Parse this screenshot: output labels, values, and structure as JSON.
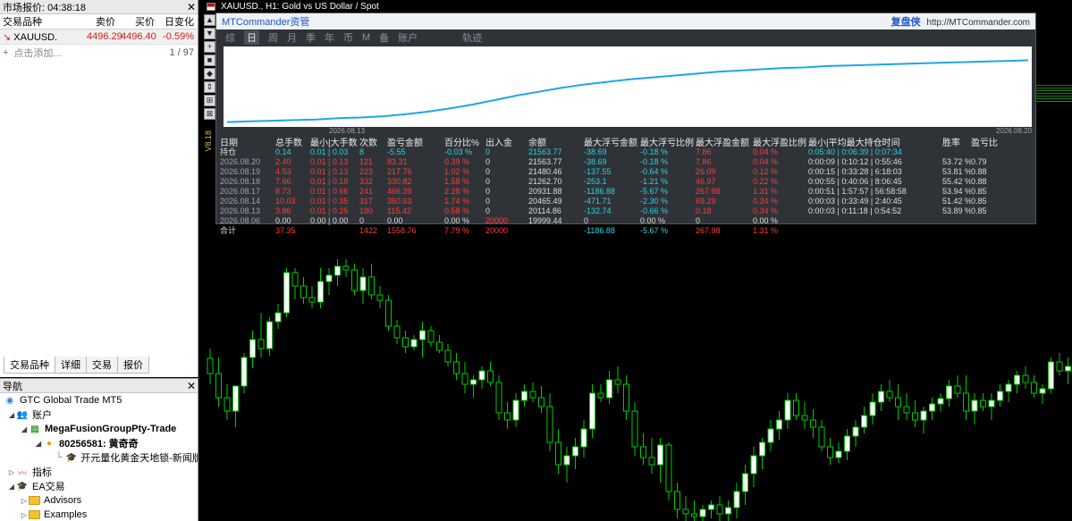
{
  "market_watch": {
    "title": "市场报价: 04:38:18",
    "columns": [
      "交易品种",
      "卖价",
      "买价",
      "日变化"
    ],
    "rows": [
      {
        "symbol": "XAUUSD.",
        "bid": "4496.29",
        "ask": "4496.40",
        "change": "-0.59%"
      }
    ],
    "add_label": "点击添加...",
    "count": "1 / 97",
    "tabs": [
      "交易品种",
      "详细",
      "交易",
      "报价"
    ]
  },
  "navigator": {
    "title": "导航",
    "items": [
      {
        "label": "GTC Global Trade MT5",
        "bold": false
      },
      {
        "label": "账户",
        "bold": false
      },
      {
        "label": "MegaFusionGroupPty-Trade",
        "bold": true
      },
      {
        "label": "80256581: 黄奇奇",
        "bold": true
      },
      {
        "label": "开元量化黄金天地锁-新闻版 - X",
        "bold": false
      },
      {
        "label": "指标",
        "bold": false
      },
      {
        "label": "EA交易",
        "bold": false
      },
      {
        "label": "Advisors",
        "bold": false
      },
      {
        "label": "Examples",
        "bold": false
      }
    ]
  },
  "chart": {
    "title": "XAUUSD., H1: Gold vs US Dollar / Spot",
    "ea_label": "V8.18",
    "toolstrip": [
      "▲",
      "▼",
      "+",
      "■",
      "◆",
      "⇕",
      "⊞",
      "⊠"
    ],
    "candles": [
      [
        401,
        390,
        430,
        418
      ],
      [
        418,
        400,
        455,
        445
      ],
      [
        445,
        430,
        470,
        460
      ],
      [
        460,
        440,
        478,
        432
      ],
      [
        432,
        395,
        440,
        400
      ],
      [
        400,
        370,
        412,
        380
      ],
      [
        380,
        350,
        400,
        390
      ],
      [
        390,
        355,
        398,
        360
      ],
      [
        360,
        340,
        368,
        350
      ],
      [
        350,
        300,
        355,
        305
      ],
      [
        305,
        300,
        335,
        320
      ],
      [
        320,
        310,
        340,
        333
      ],
      [
        333,
        320,
        345,
        338
      ],
      [
        338,
        300,
        345,
        315
      ],
      [
        315,
        300,
        330,
        308
      ],
      [
        308,
        290,
        320,
        298
      ],
      [
        298,
        290,
        310,
        302
      ],
      [
        302,
        295,
        330,
        325
      ],
      [
        325,
        300,
        340,
        310
      ],
      [
        310,
        295,
        335,
        330
      ],
      [
        330,
        320,
        345,
        336
      ],
      [
        336,
        330,
        370,
        365
      ],
      [
        365,
        358,
        385,
        378
      ],
      [
        378,
        370,
        395,
        388
      ],
      [
        388,
        375,
        392,
        380
      ],
      [
        380,
        360,
        400,
        370
      ],
      [
        370,
        365,
        388,
        383
      ],
      [
        383,
        375,
        395,
        392
      ],
      [
        392,
        385,
        410,
        405
      ],
      [
        405,
        395,
        425,
        418
      ],
      [
        418,
        405,
        440,
        430
      ],
      [
        430,
        420,
        445,
        425
      ],
      [
        425,
        410,
        435,
        415
      ],
      [
        415,
        405,
        432,
        428
      ],
      [
        428,
        420,
        470,
        462
      ],
      [
        462,
        450,
        480,
        470
      ],
      [
        470,
        440,
        478,
        448
      ],
      [
        448,
        430,
        455,
        438
      ],
      [
        438,
        428,
        450,
        445
      ],
      [
        445,
        432,
        462,
        455
      ],
      [
        455,
        440,
        505,
        495
      ],
      [
        495,
        480,
        530,
        520
      ],
      [
        520,
        500,
        540,
        510
      ],
      [
        510,
        490,
        525,
        500
      ],
      [
        500,
        470,
        512,
        480
      ],
      [
        480,
        430,
        490,
        440
      ],
      [
        440,
        430,
        450,
        445
      ],
      [
        445,
        415,
        452,
        425
      ],
      [
        425,
        410,
        440,
        430
      ],
      [
        430,
        420,
        470,
        460
      ],
      [
        460,
        450,
        510,
        500
      ],
      [
        500,
        485,
        520,
        512
      ],
      [
        512,
        490,
        530,
        520
      ],
      [
        520,
        490,
        540,
        498
      ],
      [
        498,
        495,
        560,
        550
      ],
      [
        550,
        540,
        580,
        570
      ],
      [
        570,
        555,
        583,
        575
      ],
      [
        575,
        560,
        583,
        578
      ],
      [
        578,
        565,
        583,
        570
      ],
      [
        570,
        560,
        580,
        565
      ],
      [
        565,
        555,
        583,
        575
      ],
      [
        575,
        560,
        583,
        568
      ],
      [
        568,
        540,
        580,
        550
      ],
      [
        550,
        520,
        565,
        530
      ],
      [
        530,
        500,
        545,
        510
      ],
      [
        510,
        490,
        525,
        495
      ],
      [
        495,
        470,
        505,
        480
      ],
      [
        480,
        460,
        492,
        470
      ],
      [
        470,
        440,
        480,
        448
      ],
      [
        448,
        440,
        470,
        465
      ],
      [
        465,
        450,
        480,
        470
      ],
      [
        470,
        458,
        490,
        478
      ],
      [
        478,
        470,
        505,
        500
      ],
      [
        500,
        490,
        520,
        512
      ],
      [
        512,
        495,
        518,
        505
      ],
      [
        505,
        480,
        515,
        488
      ],
      [
        488,
        470,
        500,
        478
      ],
      [
        478,
        455,
        485,
        465
      ],
      [
        465,
        440,
        475,
        450
      ],
      [
        450,
        430,
        460,
        438
      ],
      [
        438,
        425,
        450,
        445
      ],
      [
        445,
        430,
        470,
        455
      ],
      [
        455,
        440,
        470,
        462
      ],
      [
        462,
        448,
        478,
        470
      ],
      [
        470,
        455,
        485,
        460
      ],
      [
        460,
        445,
        470,
        452
      ],
      [
        452,
        440,
        460,
        446
      ],
      [
        446,
        425,
        455,
        432
      ],
      [
        432,
        420,
        445,
        440
      ],
      [
        440,
        420,
        470,
        460
      ],
      [
        460,
        440,
        475,
        448
      ],
      [
        448,
        440,
        460,
        455
      ],
      [
        455,
        440,
        470,
        448
      ],
      [
        448,
        430,
        455,
        438
      ],
      [
        438,
        425,
        450,
        430
      ],
      [
        430,
        415,
        440,
        420
      ],
      [
        420,
        410,
        435,
        428
      ],
      [
        428,
        420,
        445,
        440
      ],
      [
        440,
        430,
        452,
        435
      ],
      [
        435,
        400,
        440,
        405
      ],
      [
        405,
        395,
        420,
        415
      ],
      [
        415,
        400,
        430,
        410
      ]
    ]
  },
  "mtcommander": {
    "brand": "MTCommander资管",
    "header_right_strong": "复盘侠",
    "header_right_url": "http://MTCommander.com",
    "tabs": [
      "综",
      "日",
      "周",
      "月",
      "季",
      "年",
      "币",
      "M",
      "备",
      "账户",
      "轨迹"
    ],
    "active_tab": "日",
    "equity_dates": {
      "start": "2026.08.13",
      "end": "2026.08.20"
    },
    "equity_curve": [
      0.02,
      0.03,
      0.04,
      0.05,
      0.06,
      0.08,
      0.09,
      0.11,
      0.14,
      0.18,
      0.23,
      0.29,
      0.36,
      0.43,
      0.49,
      0.55,
      0.6,
      0.64,
      0.68,
      0.71,
      0.74,
      0.77,
      0.8,
      0.82,
      0.84,
      0.86,
      0.87,
      0.89,
      0.9,
      0.91,
      0.92,
      0.93,
      0.94,
      0.95,
      0.96,
      0.97,
      0.98
    ],
    "stats_header": [
      "日期",
      "总手数",
      "最小|大手数",
      "次数",
      "盈亏金额",
      "百分比%",
      "出入金",
      "余额",
      "最大浮亏金额",
      "最大浮亏比例",
      "最大浮盈金额",
      "最大浮盈比例",
      "最小|平均最大持仓时间",
      "胜率",
      "盈亏比"
    ],
    "holding": {
      "date": "持仓",
      "lots": "0.14",
      "min": "0.01 | 0.03",
      "count": "8",
      "pl": "-5.55",
      "pct": "-0.03 %",
      "io": "0",
      "balance": "21563.77",
      "mdd": "-38.69",
      "mddp": "-0.18 %",
      "mfe": "7.86",
      "mfep": "0.04 %",
      "time": "0:05:40 | 0:06:39 | 0:07:34",
      "win": "",
      "pf": ""
    },
    "rows": [
      {
        "date": "2026.08.20",
        "lots": "2.40",
        "min": "0.01 | 0.13",
        "count": "121",
        "pl": "83.31",
        "pct": "0.39 %",
        "io": "0",
        "balance": "21563.77",
        "mdd": "-38.69",
        "mddp": "-0.18 %",
        "mfe": "7.86",
        "mfep": "0.04 %",
        "time": "0:00:09 | 0:10:12 | 0:55:46",
        "win": "53.72 %",
        "pf": "0.79"
      },
      {
        "date": "2026.08.19",
        "lots": "4.53",
        "min": "0.01 | 0.13",
        "count": "223",
        "pl": "217.76",
        "pct": "1.02 %",
        "io": "0",
        "balance": "21480.46",
        "mdd": "-137.55",
        "mddp": "-0.64 %",
        "mfe": "26.09",
        "mfep": "0.12 %",
        "time": "0:00:15 | 0:33:28 | 6:18:03",
        "win": "53.81 %",
        "pf": "0.88"
      },
      {
        "date": "2026.08.18",
        "lots": "7.66",
        "min": "0.01 | 0.18",
        "count": "332",
        "pl": "330.82",
        "pct": "1.58 %",
        "io": "0",
        "balance": "21262.70",
        "mdd": "-253.1",
        "mddp": "-1.21 %",
        "mfe": "46.97",
        "mfep": "0.22 %",
        "time": "0:00:55 | 0:40:06 | 8:06:45",
        "win": "55.42 %",
        "pf": "0.88"
      },
      {
        "date": "2026.08.17",
        "lots": "8.73",
        "min": "0.01 | 0.66",
        "count": "241",
        "pl": "466.39",
        "pct": "2.28 %",
        "io": "0",
        "balance": "20931.88",
        "mdd": "-1186.88",
        "mddp": "-5.67 %",
        "mfe": "267.98",
        "mfep": "1.31 %",
        "time": "0:00:51 | 1:57:57 | 56:58:58",
        "win": "53.94 %",
        "pf": "0.85"
      },
      {
        "date": "2026.08.14",
        "lots": "10.03",
        "min": "0.01 | 0.35",
        "count": "317",
        "pl": "350.63",
        "pct": "1.74 %",
        "io": "0",
        "balance": "20465.49",
        "mdd": "-471.71",
        "mddp": "-2.30 %",
        "mfe": "69.29",
        "mfep": "0.34 %",
        "time": "0:00:03 | 0:33:49 | 2:40:45",
        "win": "51.42 %",
        "pf": "0.85"
      },
      {
        "date": "2026.08.13",
        "lots": "3.86",
        "min": "0.01 | 0.25",
        "count": "180",
        "pl": "115.42",
        "pct": "0.58 %",
        "io": "0",
        "balance": "20114.86",
        "mdd": "-132.74",
        "mddp": "-0.66 %",
        "mfe": "0.18",
        "mfep": "0.34 %",
        "time": "0:00:03 | 0:11:18 | 0:54:52",
        "win": "53.89 %",
        "pf": "0.85"
      },
      {
        "date": "2026.08.06",
        "lots": "0.00",
        "min": "0.00 | 0.00",
        "count": "0",
        "pl": "0.00",
        "pct": "0.00 %",
        "io": "20000",
        "balance": "19999.44",
        "mdd": "0",
        "mddp": "0.00 %",
        "mfe": "0",
        "mfep": "0.00 %",
        "time": "",
        "win": "",
        "pf": ""
      }
    ],
    "total": {
      "date": "合计",
      "lots": "37.35",
      "min": "",
      "count": "1422",
      "pl": "1558.76",
      "pct": "7.79 %",
      "io": "20000",
      "balance": "",
      "mdd": "-1186.88",
      "mddp": "-5.67 %",
      "mfe": "267.98",
      "mfep": "1.31 %",
      "time": "",
      "win": "",
      "pf": ""
    }
  },
  "colors": {
    "up": "#ffffff",
    "down": "#000000",
    "wick": "#00cc00",
    "accent": "#1f57c9",
    "loss": "#d01b1b"
  }
}
